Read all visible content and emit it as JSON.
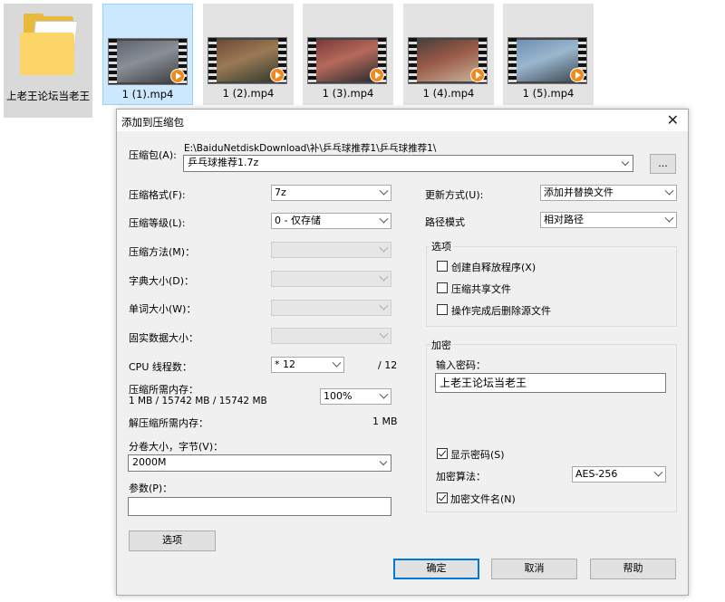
{
  "explorer": {
    "folder": {
      "name": "上老王论坛当老王"
    },
    "videos": [
      {
        "name": "1 (1).mp4",
        "colors": [
          "#5d6470",
          "#8a8f96",
          "#3c3f44"
        ]
      },
      {
        "name": "1 (2).mp4",
        "colors": [
          "#6b4a35",
          "#9b7a55",
          "#2f3a2c"
        ]
      },
      {
        "name": "1 (3).mp4",
        "colors": [
          "#7a3a3a",
          "#b56a5a",
          "#2a2a30"
        ]
      },
      {
        "name": "1 (4).mp4",
        "colors": [
          "#4a3f3a",
          "#9a5a48",
          "#c7b39a"
        ]
      },
      {
        "name": "1 (5).mp4",
        "colors": [
          "#6d8fb0",
          "#9bb7cf",
          "#3d4a55"
        ]
      }
    ]
  },
  "dialog": {
    "title": "添加到压缩包",
    "archive_label": "压缩包(A):",
    "archive_path": "E:\\BaiduNetdiskDownload\\补\\乒乓球推荐1\\乒乓球推荐1\\",
    "archive_name": "乒乓球推荐1.7z",
    "browse_label": "...",
    "format_label": "压缩格式(F):",
    "format_value": "7z",
    "level_label": "压缩等级(L):",
    "level_value": "0 - 仅存储",
    "method_label": "压缩方法(M)：",
    "dict_label": "字典大小(D)：",
    "word_label": "单词大小(W)：",
    "solid_label": "固实数据大小：",
    "cpu_label": "CPU 线程数：",
    "cpu_value": "* 12",
    "cpu_max": "/ 12",
    "mem_label": "压缩所需内存：",
    "mem_detail": "1 MB / 15742 MB / 15742 MB",
    "mem_value": "100%",
    "decomp_label": "解压缩所需内存：",
    "decomp_value": "1 MB",
    "volume_label": "分卷大小，字节(V)：",
    "volume_value": "2000M",
    "params_label": "参数(P)：",
    "options_button": "选项",
    "update_label": "更新方式(U):",
    "update_value": "添加并替换文件",
    "path_label": "路径模式",
    "path_value": "相对路径",
    "options_group": "选项",
    "opt_sfx": "创建自释放程序(X)",
    "opt_shared": "压缩共享文件",
    "opt_delete": "操作完成后删除源文件",
    "encrypt_group": "加密",
    "password_label": "输入密码：",
    "password_value": "上老王论坛当老王",
    "show_password": "显示密码(S)",
    "algo_label": "加密算法：",
    "algo_value": "AES-256",
    "encrypt_names": "加密文件名(N)",
    "ok": "确定",
    "cancel": "取消",
    "help": "帮助"
  }
}
